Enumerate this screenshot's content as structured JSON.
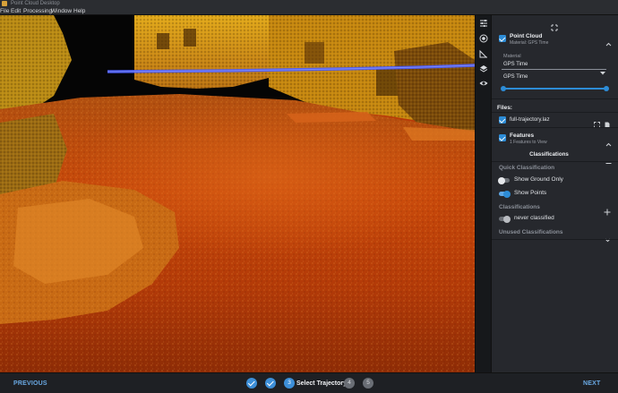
{
  "window": {
    "title": "Point Cloud Desktop"
  },
  "menu": [
    "File",
    "Edit",
    "Processing",
    "Window",
    "Help"
  ],
  "rail": {
    "tools": [
      "sliders-icon",
      "target-icon",
      "ruler-icon",
      "layers-icon",
      "eye-icon"
    ]
  },
  "panel": {
    "point_cloud": {
      "title": "Point Cloud",
      "subtitle": "Material: GPS Time",
      "material_label": "Material",
      "material_value": "GPS Time",
      "gps_label": "GPS Time",
      "gps_range": [
        0.0,
        1.0
      ]
    },
    "files": {
      "label": "Files:",
      "items": [
        {
          "name": "full-trajectory.laz",
          "checked": true
        }
      ]
    },
    "features": {
      "title": "Features",
      "subtitle": "1 Features to View",
      "tab": "Classifications",
      "quick_label": "Quick Classification",
      "show_ground_label": "Show Ground Only",
      "show_ground_on": false,
      "show_points_label": "Show Points",
      "show_points_on": true,
      "classifications_label": "Classifications",
      "never_classified_label": "never classified",
      "never_classified_on": false,
      "unused_label": "Unused Classifications"
    }
  },
  "wizard": {
    "previous": "PREVIOUS",
    "next": "NEXT",
    "steps": [
      {
        "state": "done",
        "num": "1"
      },
      {
        "state": "done",
        "num": "2"
      },
      {
        "state": "active",
        "num": "3",
        "label": "Select Trajectory"
      },
      {
        "state": "todo",
        "num": "4"
      },
      {
        "state": "todo",
        "num": "5"
      }
    ]
  },
  "colors": {
    "accent": "#2d8cd6",
    "panel_bg": "#26282d",
    "trajectory": "#4a5cff"
  }
}
